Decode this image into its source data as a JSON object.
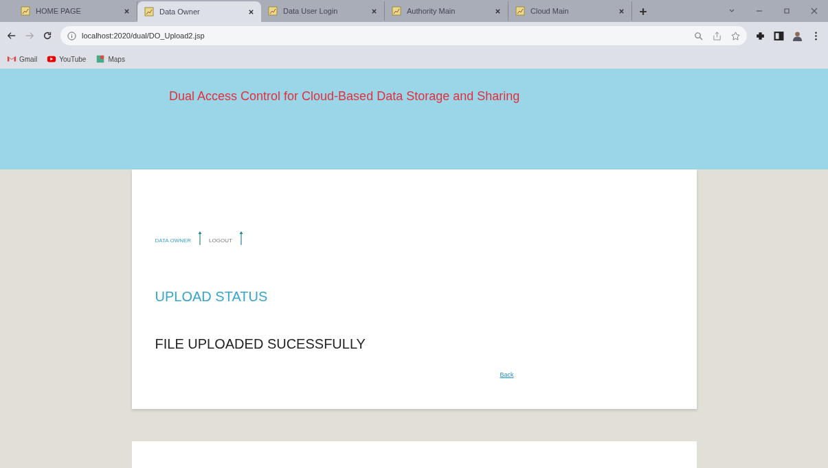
{
  "browser": {
    "tabs": [
      {
        "label": "HOME PAGE",
        "selected": false
      },
      {
        "label": "Data Owner",
        "selected": true
      },
      {
        "label": "Data User Login",
        "selected": false
      },
      {
        "label": "Authority Main",
        "selected": false
      },
      {
        "label": "Cloud Main",
        "selected": false
      }
    ],
    "url": "localhost:2020/dual/DO_Upload2.jsp",
    "bookmarks": [
      {
        "label": "Gmail",
        "kind": "gmail"
      },
      {
        "label": "YouTube",
        "kind": "youtube"
      },
      {
        "label": "Maps",
        "kind": "maps"
      }
    ]
  },
  "header": {
    "title": "Dual Access Control for Cloud-Based Data Storage and Sharing"
  },
  "nav": [
    {
      "label": "DATA OWNER",
      "selected": true
    },
    {
      "label": "LOGOUT",
      "selected": false
    }
  ],
  "heading": "UPLOAD STATUS",
  "message": "FILE UPLOADED SUCESSFULLY",
  "back_link": "Back"
}
